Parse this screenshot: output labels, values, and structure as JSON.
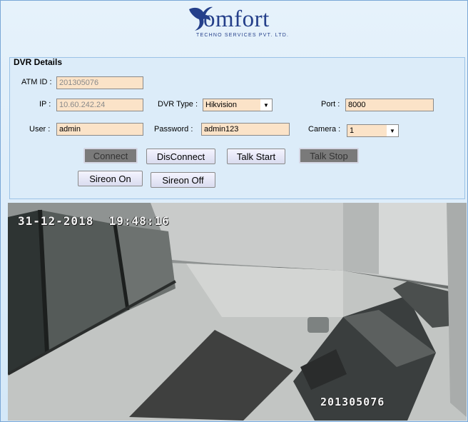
{
  "logo": {
    "wordmark": "omfort",
    "tagline": "TECHNO SERVICES PVT. LTD."
  },
  "dvr_panel": {
    "title": "DVR Details",
    "atm_id": {
      "label": "ATM ID :",
      "value": "201305076"
    },
    "ip": {
      "label": "IP :",
      "value": "10.60.242.24"
    },
    "dvr_type": {
      "label": "DVR Type :",
      "selected": "Hikvision"
    },
    "port": {
      "label": "Port :",
      "value": "8000"
    },
    "user": {
      "label": "User :",
      "value": "admin"
    },
    "password": {
      "label": "Password :",
      "value": "admin123"
    },
    "camera": {
      "label": "Camera :",
      "selected": "1"
    },
    "buttons": {
      "connect": "Connect",
      "disconnect": "DisConnect",
      "talk_start": "Talk Start",
      "talk_stop": "Talk Stop",
      "sireon_on": "Sireon On",
      "sireon_off": "Sireon Off"
    }
  },
  "video": {
    "timestamp": "31-12-2018  19:48:16",
    "camera_id": "201305076"
  },
  "colors": {
    "brand": "#243f8a",
    "field_bg": "#fbe3c8",
    "panel_bg": "#dcecf9"
  }
}
